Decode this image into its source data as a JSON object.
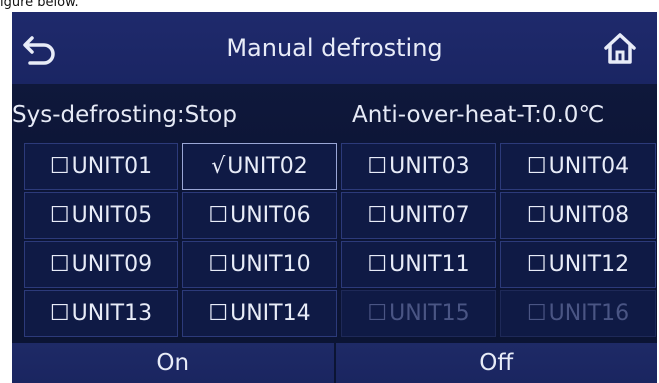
{
  "caption": "igure below.",
  "header": {
    "title": "Manual defrosting",
    "back_icon": "back-arrow-icon",
    "home_icon": "home-icon"
  },
  "status": {
    "sys_defrosting": "Sys-defrosting:Stop",
    "anti_over_heat": "Anti-over-heat-T:0.0℃"
  },
  "units": [
    {
      "mark": "☐",
      "label": "UNIT01",
      "state": "unchecked"
    },
    {
      "mark": "√",
      "label": "UNIT02",
      "state": "checked"
    },
    {
      "mark": "☐",
      "label": "UNIT03",
      "state": "unchecked"
    },
    {
      "mark": "☐",
      "label": "UNIT04",
      "state": "unchecked"
    },
    {
      "mark": "☐",
      "label": "UNIT05",
      "state": "unchecked"
    },
    {
      "mark": "☐",
      "label": "UNIT06",
      "state": "unchecked"
    },
    {
      "mark": "☐",
      "label": "UNIT07",
      "state": "unchecked"
    },
    {
      "mark": "☐",
      "label": "UNIT08",
      "state": "unchecked"
    },
    {
      "mark": "☐",
      "label": "UNIT09",
      "state": "unchecked"
    },
    {
      "mark": "☐",
      "label": "UNIT10",
      "state": "unchecked"
    },
    {
      "mark": "☐",
      "label": "UNIT11",
      "state": "unchecked"
    },
    {
      "mark": "☐",
      "label": "UNIT12",
      "state": "unchecked"
    },
    {
      "mark": "☐",
      "label": "UNIT13",
      "state": "unchecked"
    },
    {
      "mark": "☐",
      "label": "UNIT14",
      "state": "unchecked"
    },
    {
      "mark": "☐",
      "label": "UNIT15",
      "state": "disabled"
    },
    {
      "mark": "☐",
      "label": "UNIT16",
      "state": "disabled"
    }
  ],
  "footer": {
    "on_label": "On",
    "off_label": "Off"
  },
  "colors": {
    "screen_bg": "#0c1536",
    "header_bg": "#1f2a6c",
    "text": "#e8ecf8",
    "disabled_text": "#4a5584"
  }
}
